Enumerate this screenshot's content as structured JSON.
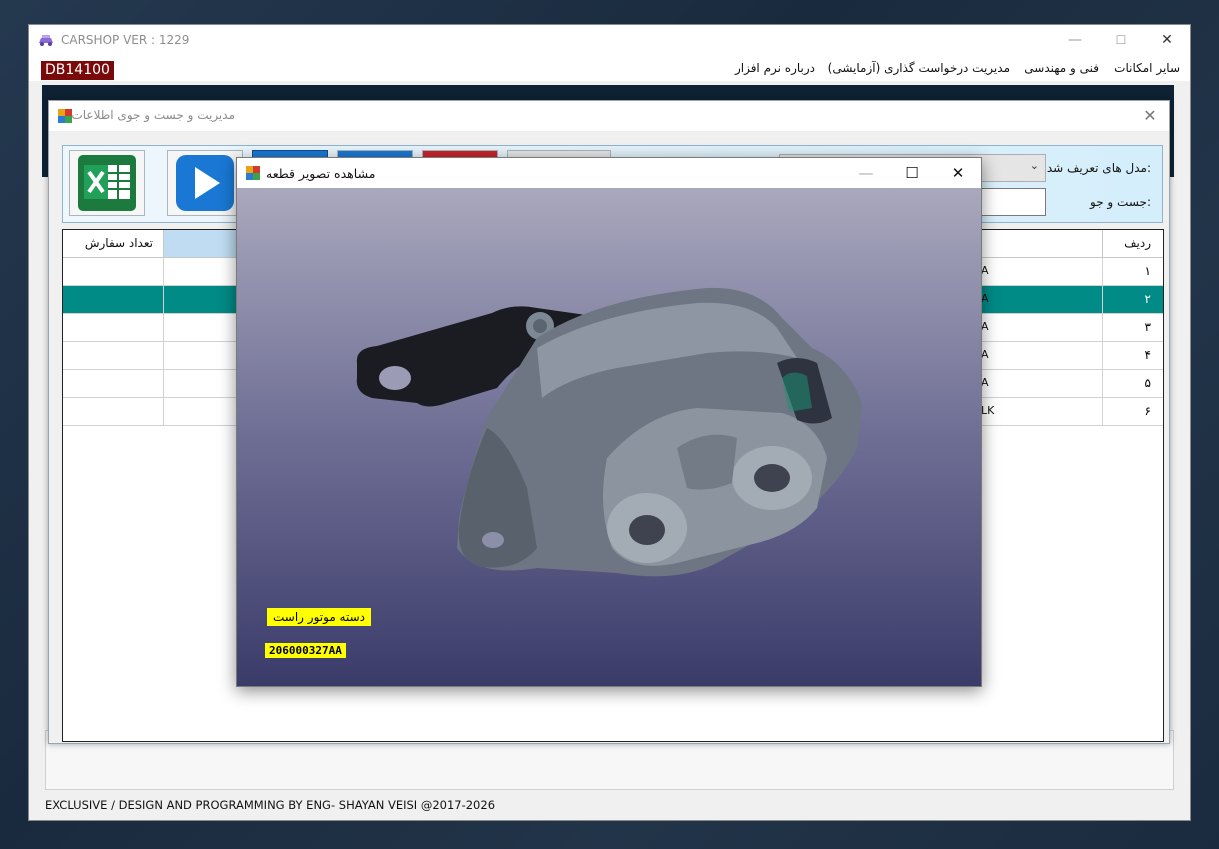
{
  "app": {
    "title": "CARSHOP VER : 1229",
    "db_badge": "DB14100",
    "footer": "EXCLUSIVE / DESIGN AND PROGRAMMING BY ENG- SHAYAN VEISI @2017-2026",
    "window_buttons": {
      "minimize": "—",
      "maximize": "☐",
      "close": "✕"
    }
  },
  "menu": {
    "items": [
      "سایر امکانات",
      "فنی و مهندسی",
      "مدیریت درخواست گذاری (آزمایشی)",
      "درباره نرم افزار"
    ]
  },
  "search_window": {
    "title": "مدیریت و جست و جوی اطلاعات",
    "close": "✕",
    "model_label": "مدل های تعریف شد:",
    "search_label": "جست و جو:",
    "model_arrow": "⌄",
    "toolbar_buttons": [
      "excel-export",
      "next"
    ]
  },
  "grid": {
    "headers": {
      "row": "ردیف",
      "qty": "تعداد سفارش"
    },
    "rows": [
      {
        "num": "۱",
        "end": "A"
      },
      {
        "num": "۲",
        "end": "A"
      },
      {
        "num": "۳",
        "end": "A"
      },
      {
        "num": "۴",
        "end": "A"
      },
      {
        "num": "۵",
        "end": "A"
      },
      {
        "num": "۶",
        "end": "LK"
      }
    ],
    "selected_row": 2
  },
  "viewer": {
    "title": "مشاهده تصویر قطعه",
    "buttons": {
      "minimize": "—",
      "maximize": "☐",
      "close": "✕"
    },
    "part_name": "دسته موتور راست",
    "part_code": "206000327AA"
  },
  "colors": {
    "accent": "#008b86",
    "badge": "#7a0a0a",
    "highlight": "#ffff00"
  }
}
